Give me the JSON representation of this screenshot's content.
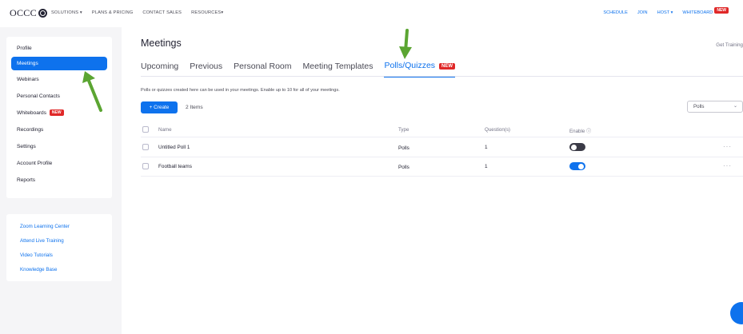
{
  "topnav": {
    "logo_text": "OCCC",
    "links": [
      "SOLUTIONS ▾",
      "PLANS & PRICING",
      "CONTACT SALES",
      "RESOURCES▾"
    ],
    "right_links": [
      "SCHEDULE",
      "JOIN",
      "HOST ▾",
      "WHITEBOARD"
    ],
    "whiteboard_badge": "NEW"
  },
  "sidebar": {
    "items": [
      {
        "label": "Profile"
      },
      {
        "label": "Meetings",
        "active": true
      },
      {
        "label": "Webinars"
      },
      {
        "label": "Personal Contacts"
      },
      {
        "label": "Whiteboards",
        "badge": "NEW"
      },
      {
        "label": "Recordings"
      },
      {
        "label": "Settings"
      },
      {
        "label": "Account Profile"
      },
      {
        "label": "Reports"
      }
    ],
    "learning": [
      "Zoom Learning Center",
      "Attend Live Training",
      "Video Tutorials",
      "Knowledge Base"
    ]
  },
  "main": {
    "title": "Meetings",
    "get_training": "Get Training",
    "tabs": [
      {
        "label": "Upcoming"
      },
      {
        "label": "Previous"
      },
      {
        "label": "Personal Room"
      },
      {
        "label": "Meeting Templates"
      },
      {
        "label": "Polls/Quizzes",
        "active": true,
        "badge": "NEW"
      }
    ],
    "description": "Polls or quizzes created here can be used in your meetings. Enable up to 10 for all of your meetings.",
    "create_label": "+ Create",
    "item_count": "2 Items",
    "filter_value": "Polls",
    "table": {
      "columns": [
        "Name",
        "Type",
        "Question(s)",
        "Enable ⓘ"
      ],
      "rows": [
        {
          "name": "Untitled Poll 1",
          "type": "Polls",
          "questions": "1",
          "enabled": false
        },
        {
          "name": "Football teams",
          "type": "Polls",
          "questions": "1",
          "enabled": true
        }
      ],
      "more_label": "···"
    }
  },
  "colors": {
    "accent": "#0e72ed",
    "badge": "#e02828",
    "arrow": "#5ba532"
  }
}
